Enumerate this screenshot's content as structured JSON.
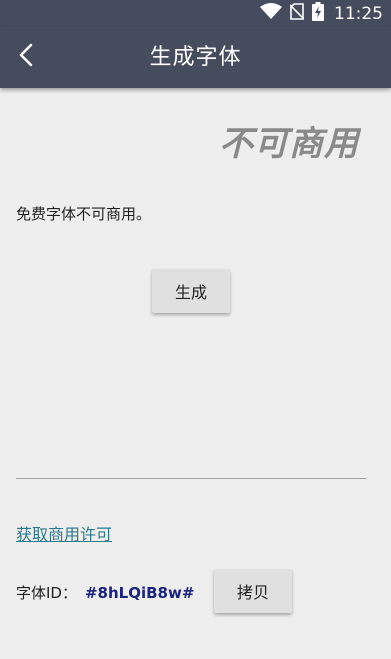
{
  "status_bar": {
    "time": "11:25",
    "icons": [
      "wifi-icon",
      "no-sim-icon",
      "battery-charging-icon"
    ]
  },
  "app_bar": {
    "title": "生成字体",
    "back_icon": "back-arrow-icon"
  },
  "preview": {
    "text": "不可商用"
  },
  "description": "免费字体不可商用。",
  "generate_button": {
    "label": "生成"
  },
  "license_link": {
    "label": "获取商用许可"
  },
  "font_id": {
    "label": "字体ID：",
    "value": "#8hLQiB8w#"
  },
  "copy_button": {
    "label": "拷贝"
  },
  "colors": {
    "app_bar": "#454c5e",
    "background": "#eeeeee",
    "link": "#2c7a8c",
    "font_id": "#1a237e",
    "preview_text": "#8a8a8a"
  }
}
